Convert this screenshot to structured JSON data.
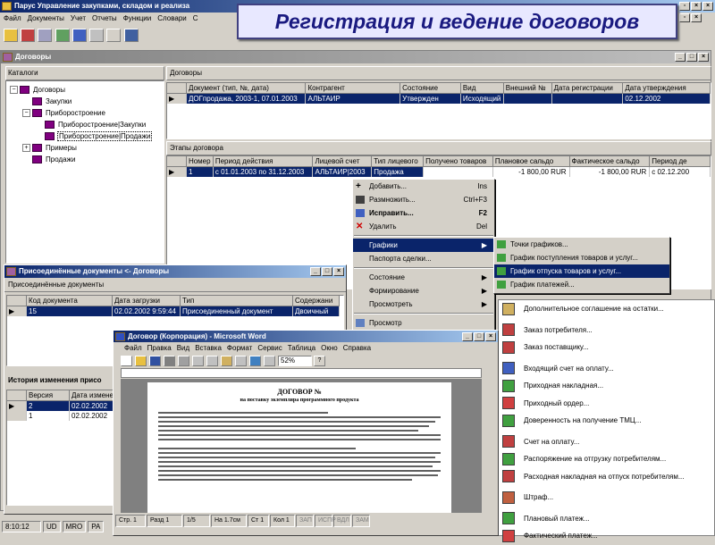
{
  "slide_title": "Регистрация и ведение договоров",
  "app": {
    "title": "Парус Управление закупками, складом и реализа",
    "menu": [
      "Файл",
      "Документы",
      "Учет",
      "Отчеты",
      "Функции",
      "Словари",
      "С"
    ]
  },
  "contracts_window": {
    "title": "Договоры",
    "catalogs_label": "Каталоги",
    "tree": [
      {
        "label": "Договоры",
        "level": 0,
        "expander": "−"
      },
      {
        "label": "Закупки",
        "level": 1,
        "expander": ""
      },
      {
        "label": "Приборостроение",
        "level": 1,
        "expander": "−"
      },
      {
        "label": "Приборостроение|Закупки",
        "level": 2,
        "expander": ""
      },
      {
        "label": "Приборостроение|Продажи",
        "level": 2,
        "expander": "",
        "selected": true
      },
      {
        "label": "Примеры",
        "level": 1,
        "expander": "+"
      },
      {
        "label": "Продажи",
        "level": 1,
        "expander": ""
      }
    ],
    "contracts_label": "Договоры",
    "contracts_columns": [
      "Документ (тип, №, дата)",
      "Контрагент",
      "Состояние",
      "Вид",
      "Внешний №",
      "Дата регистрации",
      "Дата утверждения"
    ],
    "contracts_row": [
      "ДОГпродажа, 2003-1, 07.01.2003",
      "АЛЬТАИР",
      "Утвержден",
      "Исходящий",
      "",
      "",
      "02.12.2002"
    ],
    "stages_label": "Этапы договора",
    "stages_columns": [
      "Номер",
      "Период действия",
      "Лицевой счет",
      "Тип лицевого",
      "Получено товаров",
      "Плановое сальдо",
      "Фактическое сальдо",
      "Период де"
    ],
    "stages_row": [
      "1",
      "с 01.01.2003 по 31.12.2003",
      "АЛЬТАИР|2003",
      "Продажа",
      "",
      "-1 800,00 RUR",
      "-1 800,00 RUR",
      "с 02.12.200"
    ]
  },
  "context_menu": {
    "items": [
      {
        "label": "Добавить...",
        "shortcut": "Ins",
        "icon": "add-icon"
      },
      {
        "label": "Размножить...",
        "shortcut": "Ctrl+F3",
        "icon": "duplicate-icon"
      },
      {
        "label": "Исправить...",
        "shortcut": "F2",
        "icon": "edit-icon",
        "bold": true
      },
      {
        "label": "Удалить",
        "shortcut": "Del",
        "icon": "delete-icon"
      },
      {
        "label": "Графики",
        "submenu": true,
        "highlighted": true
      },
      {
        "label": "Паспорта сделки..."
      },
      {
        "label": "Состояние",
        "submenu": true
      },
      {
        "label": "Формирование",
        "submenu": true
      },
      {
        "label": "Просмотреть",
        "submenu": true
      },
      {
        "label": "Просмотр",
        "icon": "view-icon"
      }
    ]
  },
  "charts_submenu": {
    "items": [
      {
        "label": "Точки графиков..."
      },
      {
        "label": "График поступления товаров и услуг..."
      },
      {
        "label": "График отпуска товаров и услуг...",
        "highlighted": true
      },
      {
        "label": "График платежей..."
      }
    ]
  },
  "docs_list": {
    "items": [
      "Дополнительное соглашение на остатки...",
      "Заказ потребителя...",
      "Заказ поставщику...",
      "Входящий счет на оплату...",
      "Приходная накладная...",
      "Приходный ордер...",
      "Доверенность на получение ТМЦ...",
      "Счет на оплату...",
      "Распоряжение на отгрузку потребителям...",
      "Расходная накладная на отпуск потребителям...",
      "Штраф...",
      "Плановый платеж...",
      "Фактический платеж..."
    ]
  },
  "attached_window": {
    "title": "Присоединённые документы <- Договоры",
    "label": "Присоединённые документы",
    "columns": [
      "Код документа",
      "Дата загрузки",
      "Тип",
      "Содержани"
    ],
    "row": [
      "15",
      "02.02.2002 9:59:44",
      "Присоединенный документ",
      "Двоичный"
    ],
    "history_label": "История изменения присо",
    "history_columns": [
      "Версия",
      "Дата измене"
    ],
    "history_rows": [
      [
        "2",
        "02.02.2002"
      ],
      [
        "1",
        "02.02.2002"
      ]
    ]
  },
  "word_window": {
    "title": "Договор (Корпорация) - Microsoft Word",
    "menu": [
      "Файл",
      "Правка",
      "Вид",
      "Вставка",
      "Формат",
      "Сервис",
      "Таблица",
      "Окно",
      "Справка"
    ],
    "zoom": "52%",
    "doc_heading": "ДОГОВОР №",
    "doc_subheading": "на поставку экземпляра программного продукта",
    "status": [
      "Стр. 1",
      "Разд 1",
      "1/5",
      "На 1.7см",
      "Ст 1",
      "Кол 1",
      "ЗАП",
      "ИСПР",
      "ВДЛ",
      "ЗАМ"
    ]
  },
  "status_bar": {
    "time": "8:10:12",
    "cells": [
      "UD",
      "MRO",
      "PA"
    ]
  }
}
